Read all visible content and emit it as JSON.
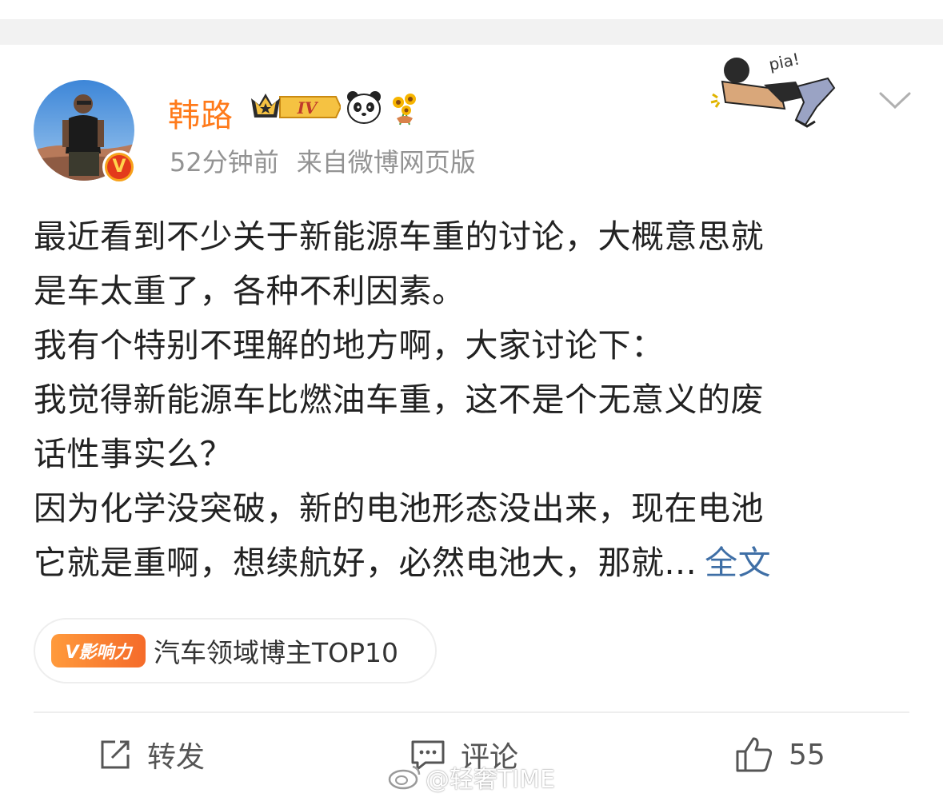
{
  "post": {
    "author": "韩路",
    "vip_level": "IV",
    "time": "52分钟前",
    "source": "来自微博网页版",
    "sticker_text": "pia!",
    "verify_mark": "V",
    "lines": [
      "最近看到不少关于新能源车重的讨论，大概意思就",
      "是车太重了，各种不利因素。",
      "我有个特别不理解的地方啊，大家讨论下：",
      "我觉得新能源车比燃油车重，这不是个无意义的废",
      "话性事实么？",
      "因为化学没突破，新的电池形态没出来，现在电池",
      "它就是重啊，想续航好，必然电池大，那就..."
    ],
    "full_text_link": "全文",
    "influence_tag": "V影响力",
    "influence_text": "汽车领域博主TOP10"
  },
  "actions": {
    "repost_label": "转发",
    "comment_label": "评论",
    "like_count": "55"
  },
  "watermark": "@轻奢TIME",
  "colors": {
    "username": "#ff7a1a",
    "link": "#3f6fa6",
    "meta": "#939393",
    "body_text": "#222222"
  },
  "icons": [
    "vip-crown-icon",
    "panda-icon",
    "sunflower-icon",
    "chevron-down-icon",
    "repost-icon",
    "comment-icon",
    "like-icon",
    "weibo-logo-icon"
  ]
}
